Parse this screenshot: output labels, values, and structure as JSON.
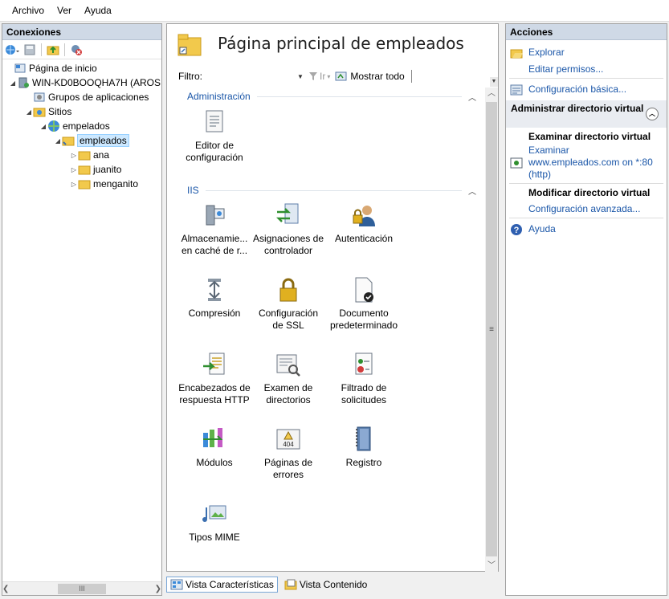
{
  "menu": {
    "items": [
      "Archivo",
      "Ver",
      "Ayuda"
    ]
  },
  "connections": {
    "title": "Conexiones",
    "tree": [
      {
        "label": "Página de inicio"
      },
      {
        "label": "WIN-KD0BOOQHA7H (AROS"
      },
      {
        "label": "Grupos de aplicaciones"
      },
      {
        "label": "Sitios"
      },
      {
        "label": "empelados"
      },
      {
        "label": "empleados"
      },
      {
        "label": "ana"
      },
      {
        "label": "juanito"
      },
      {
        "label": "menganito"
      }
    ],
    "scroll_grip": "III"
  },
  "center": {
    "title": "Página principal de empleados",
    "filter_label": "Filtro:",
    "go_label": "Ir",
    "show_all_label": "Mostrar todo",
    "groups": {
      "admin": "Administración",
      "iis": "IIS"
    },
    "features": [
      {
        "l1": "Editor de",
        "l2": "configuración"
      },
      {
        "l1": "Almacenamie...",
        "l2": "en caché de r..."
      },
      {
        "l1": "Asignaciones de",
        "l2": "controlador"
      },
      {
        "l1": "Autenticación",
        "l2": ""
      },
      {
        "l1": "Compresión",
        "l2": ""
      },
      {
        "l1": "Configuración",
        "l2": "de SSL"
      },
      {
        "l1": "Documento",
        "l2": "predeterminado"
      },
      {
        "l1": "Encabezados de",
        "l2": "respuesta HTTP"
      },
      {
        "l1": "Examen de",
        "l2": "directorios"
      },
      {
        "l1": "Filtrado de",
        "l2": "solicitudes"
      },
      {
        "l1": "Módulos",
        "l2": ""
      },
      {
        "l1": "Páginas de",
        "l2": "errores"
      },
      {
        "l1": "Registro",
        "l2": ""
      },
      {
        "l1": "Tipos MIME",
        "l2": ""
      }
    ],
    "error_icon_text": "404"
  },
  "viewtabs": {
    "features": "Vista Características",
    "content": "Vista Contenido"
  },
  "actions": {
    "title": "Acciones",
    "explore": "Explorar",
    "edit_perms": "Editar permisos...",
    "basic_config": "Configuración básica...",
    "section_title": "Administrar directorio virtual",
    "browse_vdir_title": "Examinar directorio virtual",
    "browse_l1": "Examinar",
    "browse_l2": "www.empleados.com on *:80",
    "browse_l3": "(http)",
    "modify_vdir_title": "Modificar directorio virtual",
    "advanced_config": "Configuración avanzada...",
    "help": "Ayuda"
  },
  "colors": {
    "link": "#1a56a8",
    "panel_header": "#cfd9e6",
    "selection": "#cce8ff"
  }
}
